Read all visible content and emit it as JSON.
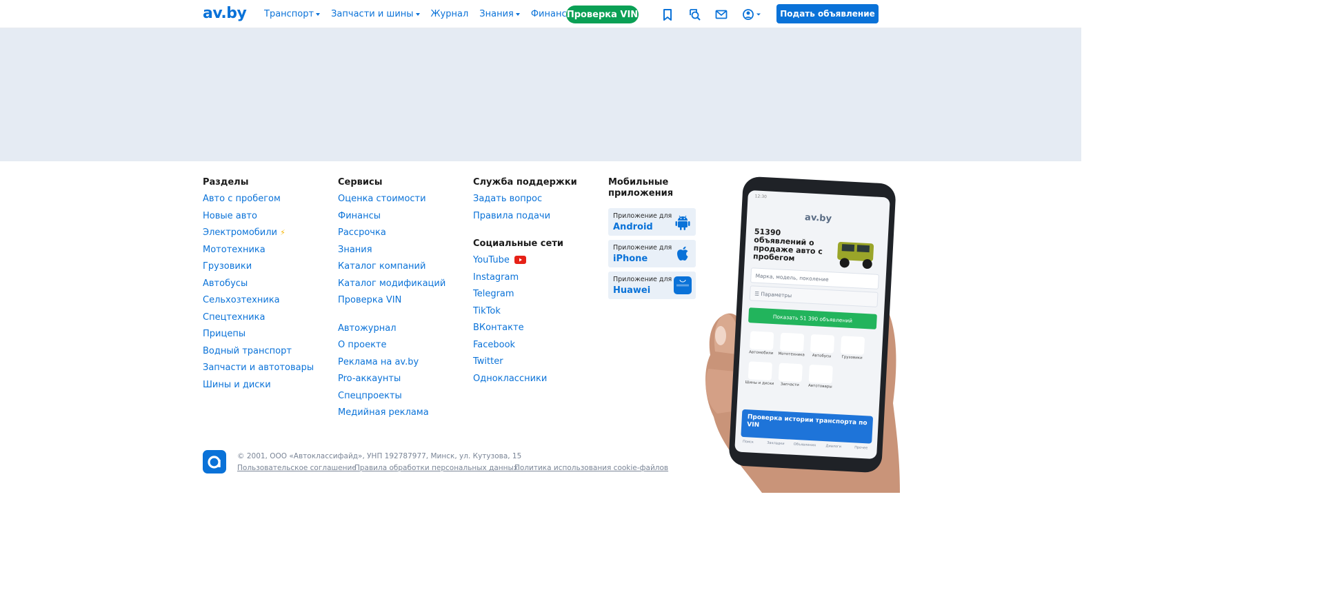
{
  "header": {
    "logo": "av.by",
    "nav": [
      {
        "label": "Транспорт",
        "dropdown": true
      },
      {
        "label": "Запчасти и шины",
        "dropdown": true
      },
      {
        "label": "Журнал",
        "dropdown": false
      },
      {
        "label": "Знания",
        "dropdown": true
      },
      {
        "label": "Финансы",
        "dropdown": false
      }
    ],
    "vin_button": "Проверка VIN",
    "icons": [
      "bookmark-icon",
      "search-history-icon",
      "mail-icon",
      "user-icon"
    ],
    "post_button": "Подать объявление"
  },
  "footer": {
    "sections": {
      "title": "Разделы",
      "links": [
        "Авто с пробегом",
        "Новые авто",
        "Электромобили",
        "Мототехника",
        "Грузовики",
        "Автобусы",
        "Сельхозтехника",
        "Спецтехника",
        "Прицепы",
        "Водный транспорт",
        "Запчасти и автотовары",
        "Шины и диски"
      ]
    },
    "services": {
      "title": "Сервисы",
      "links": [
        "Оценка стоимости",
        "Финансы",
        "Рассрочка",
        "Знания",
        "Каталог компаний",
        "Каталог модификаций",
        "Проверка VIN"
      ],
      "links2": [
        "Автожурнал",
        "О проекте",
        "Реклама на av.by",
        "Pro-аккаунты",
        "Спецпроекты",
        "Медийная реклама"
      ]
    },
    "support": {
      "title": "Служба поддержки",
      "links": [
        "Задать вопрос",
        "Правила подачи"
      ]
    },
    "social": {
      "title": "Социальные сети",
      "links": [
        "YouTube",
        "Instagram",
        "Telegram",
        "TikTok",
        "ВКонтакте",
        "Facebook",
        "Twitter",
        "Одноклассники"
      ]
    },
    "apps": {
      "title": "Мобильные приложения",
      "items": [
        {
          "small": "Приложение для",
          "name": "Android",
          "icon": "android-icon"
        },
        {
          "small": "Приложение для",
          "name": "iPhone",
          "icon": "apple-icon"
        },
        {
          "small": "Приложение для",
          "name": "Huawei",
          "icon": "huawei-icon"
        }
      ]
    },
    "copyright": "© 2001, ООО «Автоклассифайд», УНП 192787977, Минск, ул. Кутузова, 15",
    "legal": [
      "Пользовательское соглашение",
      "Правила обработки персональных данных",
      "Политика использования cookie-файлов"
    ]
  },
  "phone": {
    "time": "12:30",
    "logo": "av.by",
    "headline": "51390 объявлений о продаже авто с пробегом",
    "search_placeholder": "Марка, модель, поколение",
    "params_label": "Параметры",
    "show_button": "Показать 51 390 объявлений",
    "categories": [
      "Автомобили",
      "Мототехника",
      "Автобусы",
      "Грузовики",
      "Шины и диски",
      "Запчасти",
      "Автотовары"
    ],
    "promo": "Проверка истории транспорта по VIN",
    "tabs": [
      "Поиск",
      "Закладки",
      "Объявления",
      "Диалоги",
      "Прочее"
    ]
  },
  "colors": {
    "brand": "#0a72d8",
    "vin_green": "#0aa055",
    "banner_bg": "#e5ebf3",
    "app_card_bg": "#e9f0f8"
  }
}
